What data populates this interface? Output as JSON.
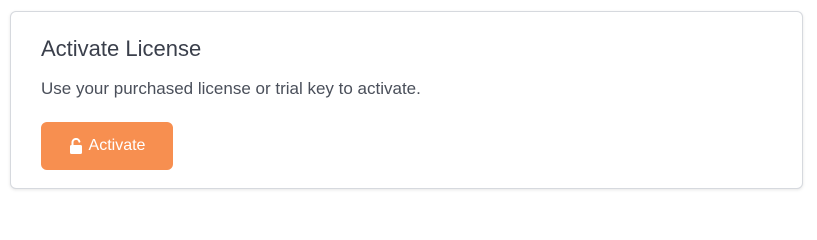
{
  "card": {
    "title": "Activate License",
    "description": "Use your purchased license or trial key to activate.",
    "activate_button": {
      "label": "Activate",
      "icon": "unlock-icon",
      "color": "#f78f50"
    }
  }
}
